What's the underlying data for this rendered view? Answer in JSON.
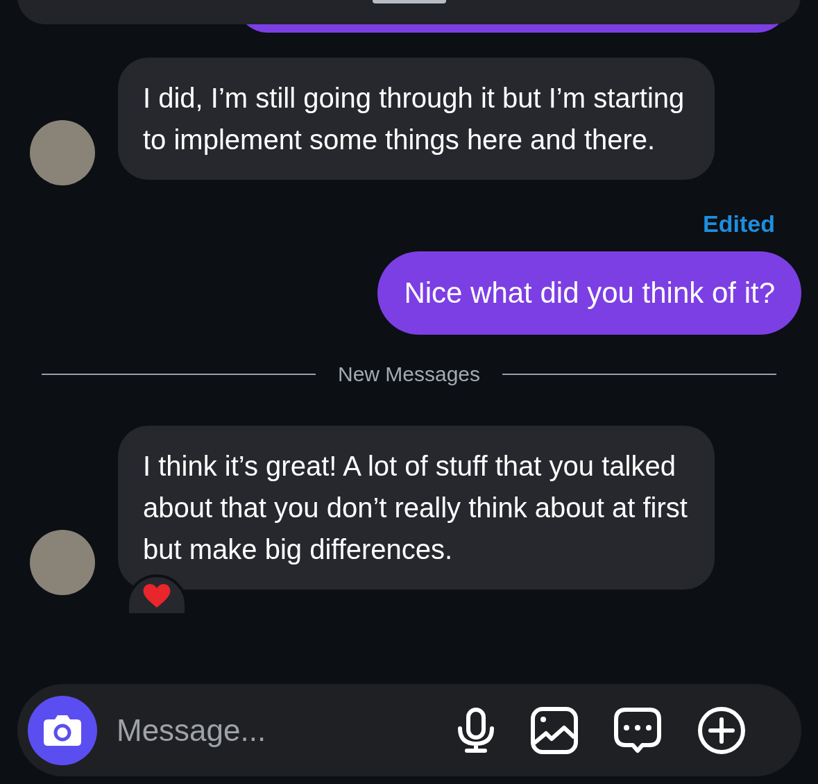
{
  "messages": [
    {
      "kind": "incoming",
      "text": "I did, I’m still going through it but I’m starting to implement some things here and there.",
      "reacted": false
    },
    {
      "kind": "edited",
      "text": "Edited"
    },
    {
      "kind": "outgoing",
      "text": "Nice what did you think of it?"
    },
    {
      "kind": "divider",
      "text": "New Messages"
    },
    {
      "kind": "incoming",
      "text": "I think it’s great! A lot of stuff that you talked about that you don’t really think about at first but make big differences.",
      "reacted": true
    }
  ],
  "composer": {
    "placeholder": "Message..."
  }
}
